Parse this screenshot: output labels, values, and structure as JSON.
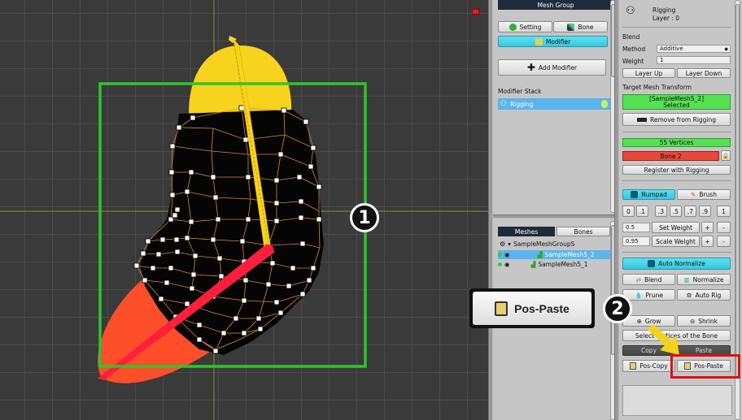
{
  "viewport": {
    "callout_1": "1",
    "callout_2": "2"
  },
  "mid_panel": {
    "header": "Mesh Group",
    "setting_label": "Setting",
    "bone_label": "Bone",
    "modifier_label": "Modifier",
    "add_modifier_label": "Add Modifier",
    "modifier_stack_label": "Modifier Stack",
    "stack_items": [
      {
        "label": "Rigging"
      }
    ],
    "tabs": {
      "meshes": "Meshes",
      "bones": "Bones"
    },
    "tree": {
      "root": "SampleMeshGroupS",
      "items": [
        {
          "label": "SampleMesh5_2"
        },
        {
          "label": "SampleMesh5_1"
        }
      ]
    }
  },
  "right_panel": {
    "title": "Rigging",
    "layer": "Layer : 0",
    "blend_label": "Blend",
    "method_label": "Method",
    "method_value": "Additive",
    "weight_label": "Weight",
    "weight_value": "1",
    "layer_up": "Layer Up",
    "layer_down": "Layer Down",
    "target_label": "Target Mesh Transform",
    "target_name": "[SampleMesh5_2]",
    "target_status": "Selected",
    "remove_rigging": "Remove from Rigging",
    "vertices": "55 Vertices",
    "bone": "Bone 2",
    "register": "Register with Rigging",
    "numpad": "Numpad",
    "brush": "Brush",
    "numpad_values": [
      "0",
      ".1",
      ".3",
      ".5",
      ".7",
      ".9",
      "1"
    ],
    "set_weight_value": "0.5",
    "set_weight": "Set Weight",
    "scale_weight_value": "0.95",
    "scale_weight": "Scale Weight",
    "plus": "+",
    "minus": "-",
    "auto_normalize": "Auto Normalize",
    "blend": "Blend",
    "normalize": "Normalize",
    "prune": "Prune",
    "auto_rig": "Auto Rig",
    "grow": "Grow",
    "shrink": "Shrink",
    "select_vertices": "Select Vertices of the Bone",
    "copy": "Copy",
    "paste": "Paste",
    "pos_copy": "Pos-Copy",
    "pos_paste": "Pos-Paste"
  },
  "callout_button": {
    "label": "Pos-Paste"
  },
  "colors": {
    "cyan": "#34c8e0",
    "green": "#55e055",
    "red": "#e8483a",
    "highlight": "#e21010"
  }
}
